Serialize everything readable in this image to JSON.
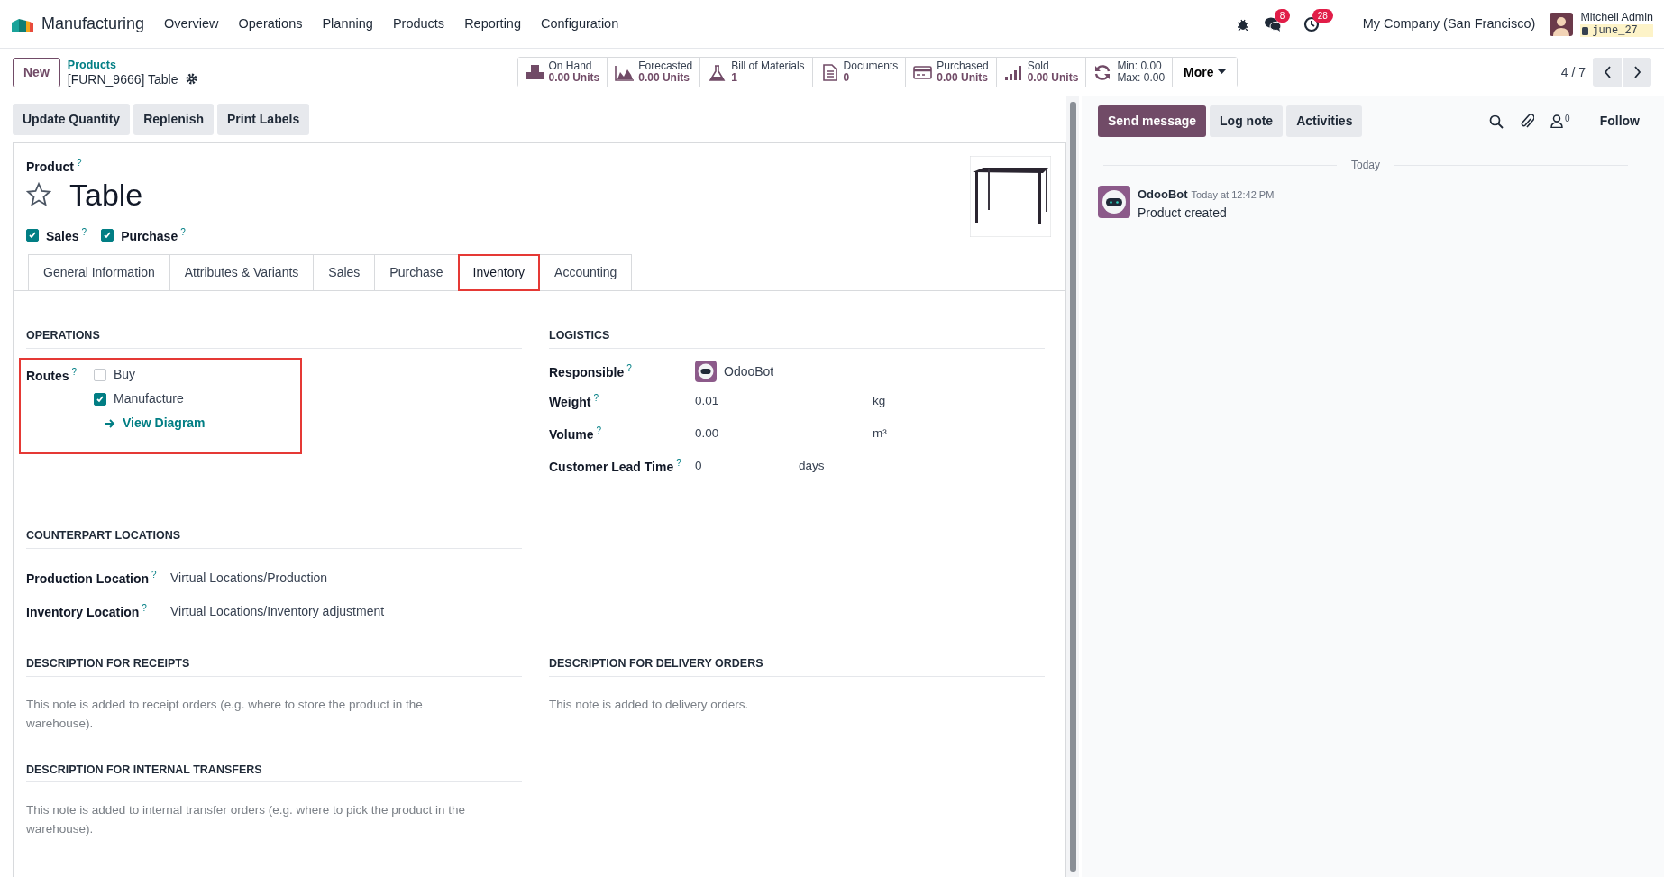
{
  "app": {
    "name": "Manufacturing",
    "menu": [
      "Overview",
      "Operations",
      "Planning",
      "Products",
      "Reporting",
      "Configuration"
    ]
  },
  "systray": {
    "messages_badge": "8",
    "activities_badge": "28",
    "company": "My Company (San Francisco)",
    "user": "Mitchell Admin",
    "database": "june_27"
  },
  "control_panel": {
    "new_button": "New",
    "breadcrumb": "Products",
    "record": "[FURN_9666] Table",
    "more": "More",
    "pager": "4 / 7",
    "smart_buttons": [
      {
        "kind": "boxes",
        "label": "On Hand",
        "value": "0.00 Units"
      },
      {
        "kind": "area",
        "label": "Forecasted",
        "value": "0.00 Units"
      },
      {
        "kind": "flask",
        "label": "Bill of Materials",
        "value": "1"
      },
      {
        "kind": "document",
        "label": "Documents",
        "value": "0"
      },
      {
        "kind": "card",
        "label": "Purchased",
        "value": "0.00 Units"
      },
      {
        "kind": "bars",
        "label": "Sold",
        "value": "0.00 Units"
      },
      {
        "kind": "refresh",
        "label": "Min: 0.00",
        "value": "Max: 0.00"
      }
    ]
  },
  "actions": [
    "Update Quantity",
    "Replenish",
    "Print Labels"
  ],
  "form": {
    "field_label": "Product",
    "help": "?",
    "name": "Table",
    "favorite": false,
    "options": [
      {
        "label": "Sales",
        "help": "?",
        "checked": true
      },
      {
        "label": "Purchase",
        "help": "?",
        "checked": true
      }
    ],
    "tabs": [
      {
        "label": "General Information",
        "selected": false,
        "highlighted": false
      },
      {
        "label": "Attributes & Variants",
        "selected": false,
        "highlighted": false
      },
      {
        "label": "Sales",
        "selected": false,
        "highlighted": false
      },
      {
        "label": "Purchase",
        "selected": false,
        "highlighted": false
      },
      {
        "label": "Inventory",
        "selected": true,
        "highlighted": true
      },
      {
        "label": "Accounting",
        "selected": false,
        "highlighted": false
      }
    ],
    "operations": {
      "title": "OPERATIONS",
      "label": "Routes",
      "help": "?",
      "highlighted": true,
      "routes": [
        {
          "label": "Buy",
          "checked": false
        },
        {
          "label": "Manufacture",
          "checked": true
        }
      ],
      "link": "View Diagram"
    },
    "logistics": {
      "title": "LOGISTICS",
      "fields": [
        {
          "kind": "user",
          "label": "Responsible",
          "help": "?",
          "value": "OdooBot"
        },
        {
          "kind": "unit",
          "label": "Weight",
          "help": "?",
          "value": "0.01",
          "unit": "kg"
        },
        {
          "kind": "unit",
          "label": "Volume",
          "help": "?",
          "value": "0.00",
          "unit": "m³"
        },
        {
          "kind": "unit_short",
          "label": "Customer Lead Time",
          "help": "?",
          "value": "0",
          "unit": "days"
        }
      ]
    },
    "counterpart": {
      "title": "COUNTERPART LOCATIONS",
      "fields": [
        {
          "label": "Production Location",
          "help": "?",
          "value": "Virtual Locations/Production"
        },
        {
          "label": "Inventory Location",
          "help": "?",
          "value": "Virtual Locations/Inventory adjustment"
        }
      ]
    },
    "descriptions": [
      {
        "title": "DESCRIPTION FOR RECEIPTS",
        "placeholder": "This note is added to receipt orders (e.g. where to store the product in the warehouse)."
      },
      {
        "title": "DESCRIPTION FOR DELIVERY ORDERS",
        "placeholder": "This note is added to delivery orders."
      },
      {
        "title": "DESCRIPTION FOR INTERNAL TRANSFERS",
        "placeholder": "This note is added to internal transfer orders (e.g. where to pick the product in the warehouse)."
      }
    ]
  },
  "chatter": {
    "buttons": [
      {
        "label": "Send message",
        "selected": true
      },
      {
        "label": "Log note",
        "selected": false
      },
      {
        "label": "Activities",
        "selected": false
      }
    ],
    "followers_count": "0",
    "follow": "Follow",
    "date_separator": "Today",
    "messages": [
      {
        "author": "OdooBot",
        "time": "Today at 12:42 PM",
        "body": "Product created"
      }
    ]
  }
}
